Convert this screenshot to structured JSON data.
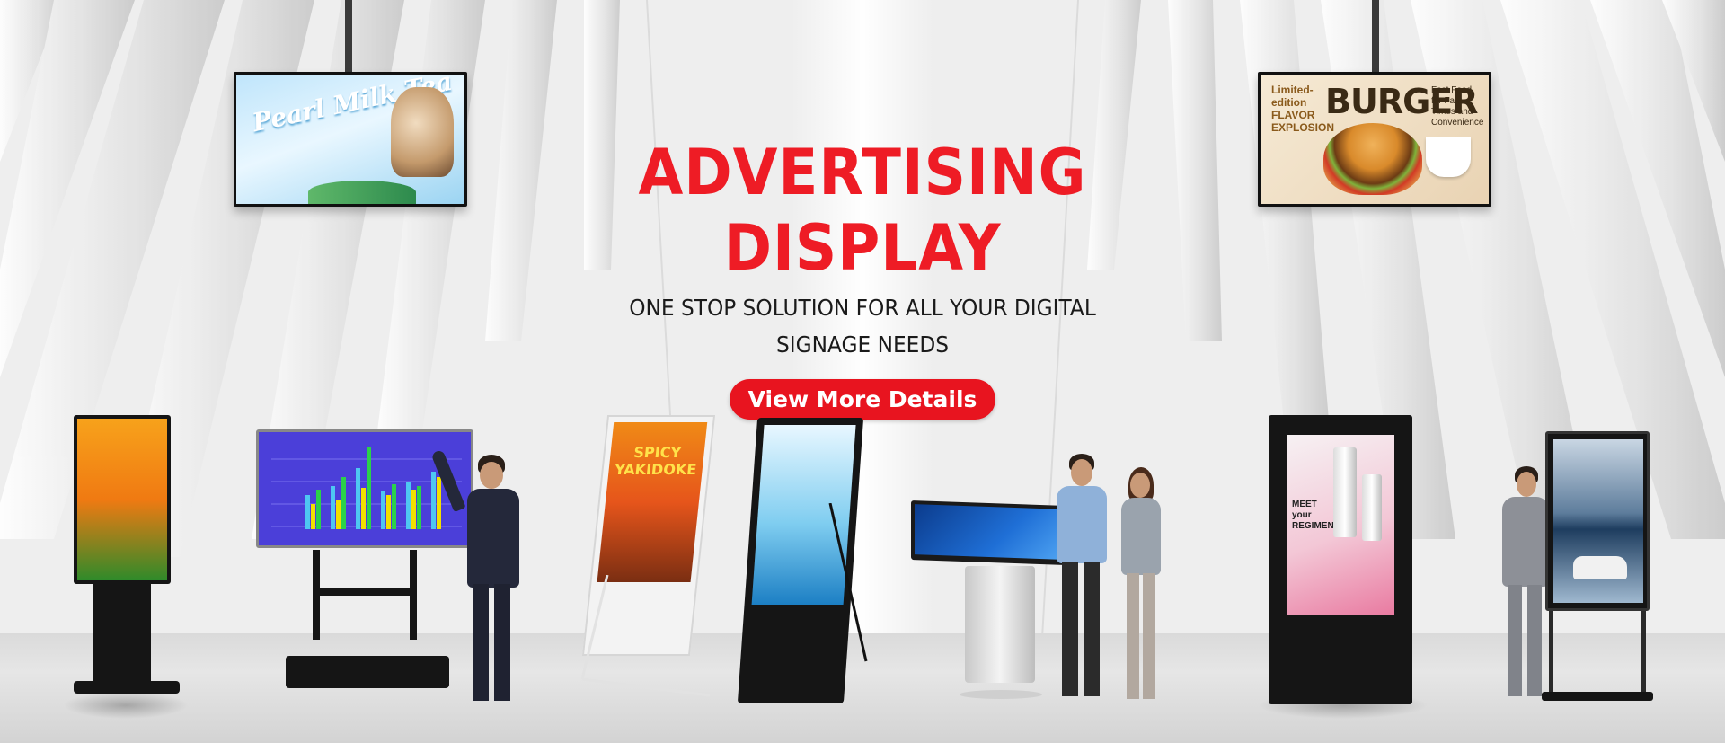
{
  "hero": {
    "headline": "ADVERTISING DISPLAY",
    "subline": "ONE STOP SOLUTION FOR ALL YOUR DIGITAL SIGNAGE NEEDS",
    "cta_label": "View More Details"
  },
  "colors": {
    "accent": "#ee1c25",
    "cta_bg": "#e8141f",
    "text_dark": "#1a1a1a"
  },
  "displays": {
    "left_hanging": {
      "title": "Pearl Milk Tea"
    },
    "right_hanging": {
      "small": "Limited-edition FLAVOR EXPLOSION",
      "big": "BURGER",
      "tag": "Fast Food for Fast Times and Convenience"
    },
    "kiosk_poster": {
      "title": "SPICY YAKIDOKE"
    },
    "cosmetic": {
      "text": "MEET your REGIMEN"
    }
  }
}
